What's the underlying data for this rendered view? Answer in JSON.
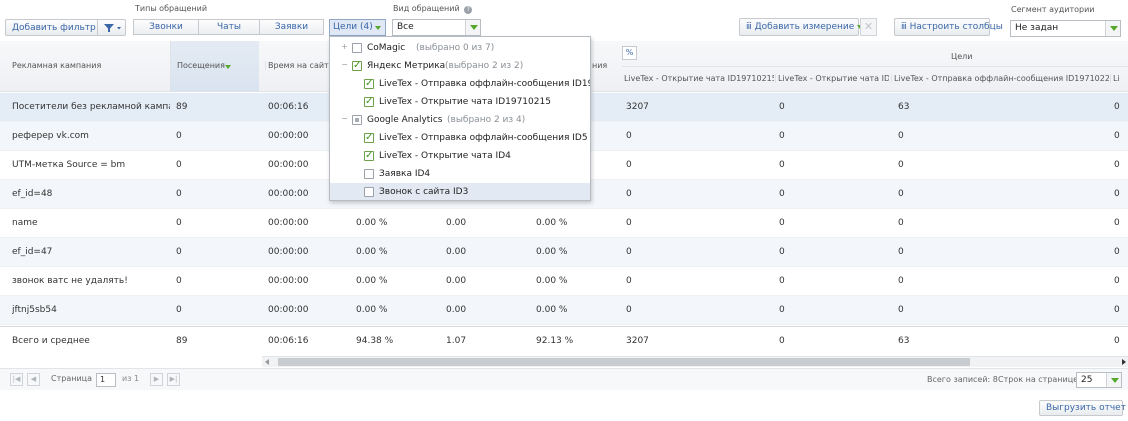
{
  "toolbar": {
    "add_filter": "Добавить фильтр",
    "request_types_label": "Типы обращений",
    "request_types_tabs": [
      "Звонки",
      "Чаты",
      "Заявки"
    ],
    "goals_button": "Цели (4)",
    "request_view_label": "Вид обращений",
    "request_view_value": "Все",
    "add_dimension": "Добавить измерение",
    "configure_columns": "Настроить столбцы",
    "segment_label": "Сегмент аудитории",
    "segment_value": "Не задан"
  },
  "goals_dropdown": {
    "groups": [
      {
        "name": "CoMagic",
        "count": "(выбрано 0 из 7)",
        "state": "unchecked",
        "toggle": "+",
        "items": []
      },
      {
        "name": "Яндекс Метрика",
        "count": "(выбрано 2 из 2)",
        "state": "checked",
        "toggle": "−",
        "items": [
          {
            "label": "LiveTex - Отправка оффлайн-сообщения ID1971022",
            "checked": true
          },
          {
            "label": "LiveTex - Открытие чата ID19710215",
            "checked": true
          }
        ]
      },
      {
        "name": "Google Analytics",
        "count": "(выбрано 2 из 4)",
        "state": "partial",
        "toggle": "−",
        "items": [
          {
            "label": "LiveTex - Отправка оффлайн-сообщения ID5",
            "checked": true
          },
          {
            "label": "LiveTex - Открытие чата ID4",
            "checked": true
          },
          {
            "label": "Заявка ID4",
            "checked": false
          },
          {
            "label": "Звонок с сайта ID3",
            "checked": false
          }
        ]
      }
    ]
  },
  "table": {
    "headers": {
      "campaign": "Рекламная кампания",
      "visits": "Посещения",
      "time_on_site": "Время на сайте",
      "partial_col": "ния",
      "percent_icon": "%",
      "goals_group": "Цели",
      "goal_cols": [
        "LiveTex - Открытие чата ID19710215",
        "LiveTex - Открытие чата ID4",
        "LiveTex - Отправка оффлайн-сообщения ID19710220",
        "Li"
      ]
    },
    "rows": [
      {
        "campaign": "Посетители без рекламной кампан…",
        "visits": "89",
        "time": "00:06:16",
        "c1": "",
        "c2": "",
        "c3": "",
        "g1": "3207",
        "g2": "0",
        "g3": "63",
        "g4": "0"
      },
      {
        "campaign": "реферер vk.com",
        "visits": "0",
        "time": "00:00:00",
        "c1": "",
        "c2": "",
        "c3": "",
        "g1": "0",
        "g2": "0",
        "g3": "0",
        "g4": "0"
      },
      {
        "campaign": "UTM-метка Source = bm",
        "visits": "0",
        "time": "00:00:00",
        "c1": "",
        "c2": "",
        "c3": "",
        "g1": "0",
        "g2": "0",
        "g3": "0",
        "g4": "0"
      },
      {
        "campaign": "ef_id=48",
        "visits": "0",
        "time": "00:00:00",
        "c1": "",
        "c2": "",
        "c3": "",
        "g1": "0",
        "g2": "0",
        "g3": "0",
        "g4": "0"
      },
      {
        "campaign": "name",
        "visits": "0",
        "time": "00:00:00",
        "c1": "0.00 %",
        "c2": "0.00",
        "c3": "0.00 %",
        "g1": "0",
        "g2": "0",
        "g3": "0",
        "g4": "0"
      },
      {
        "campaign": "ef_id=47",
        "visits": "0",
        "time": "00:00:00",
        "c1": "0.00 %",
        "c2": "0.00",
        "c3": "0.00 %",
        "g1": "0",
        "g2": "0",
        "g3": "0",
        "g4": "0"
      },
      {
        "campaign": "звонок ватс не удалять!",
        "visits": "0",
        "time": "00:00:00",
        "c1": "0.00 %",
        "c2": "0.00",
        "c3": "0.00 %",
        "g1": "0",
        "g2": "0",
        "g3": "0",
        "g4": "0"
      },
      {
        "campaign": "jftnj5sb54",
        "visits": "0",
        "time": "00:00:00",
        "c1": "0.00 %",
        "c2": "0.00",
        "c3": "0.00 %",
        "g1": "0",
        "g2": "0",
        "g3": "0",
        "g4": "0"
      }
    ],
    "total": {
      "campaign": "Всего и среднее",
      "visits": "89",
      "time": "00:06:16",
      "c1": "94.38 %",
      "c2": "1.07",
      "c3": "92.13 %",
      "g1": "3207",
      "g2": "0",
      "g3": "63",
      "g4": "0"
    }
  },
  "pager": {
    "page_label": "Страница",
    "page_value": "1",
    "of_label": "из 1",
    "total_records": "Всего записей: 8",
    "rows_per_page_label": "Строк на странице",
    "rows_per_page_value": "25"
  },
  "export_button": "Выгрузить отчет"
}
